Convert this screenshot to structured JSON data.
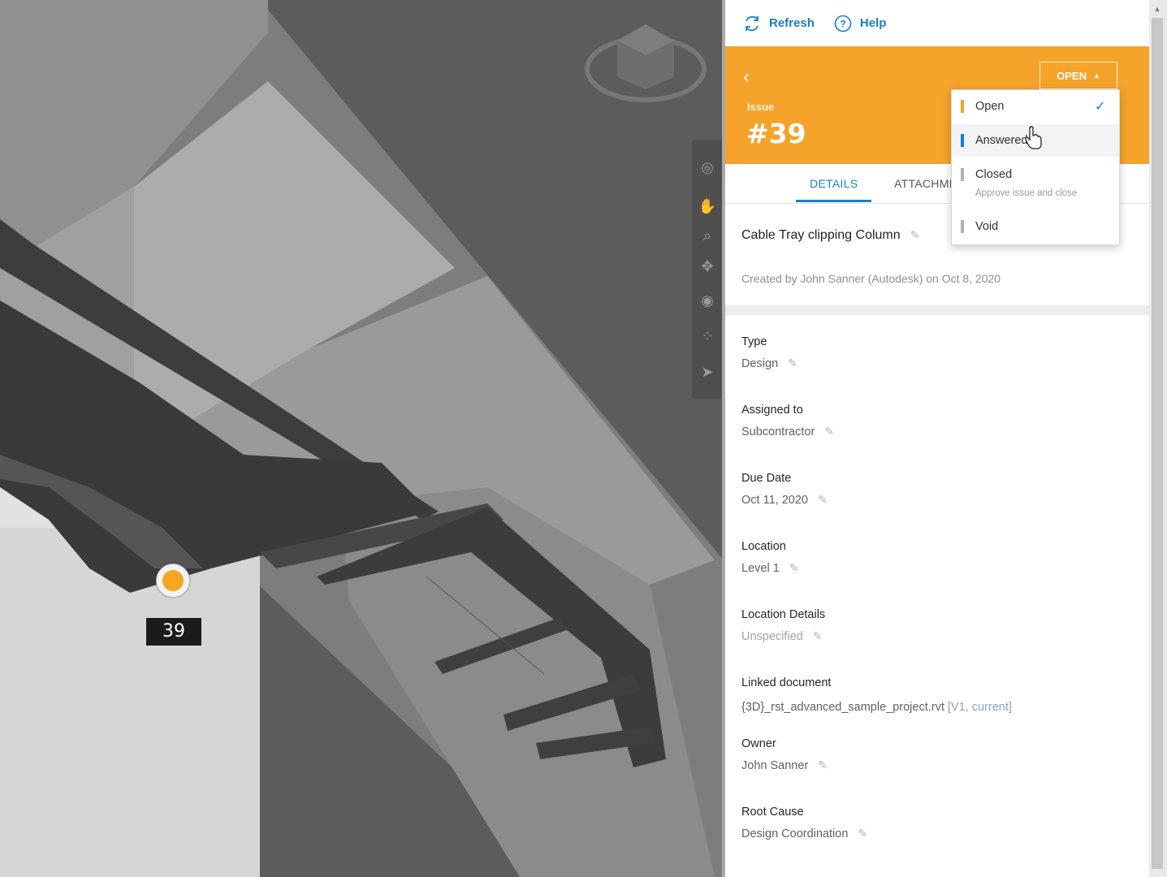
{
  "viewer": {
    "pin_number": "39",
    "toolbar_icons": [
      "orbit-icon",
      "pan-icon",
      "zoom-icon",
      "fit-view-icon",
      "look-icon",
      "walk-icon",
      "select-icon"
    ]
  },
  "panel": {
    "toolbar": {
      "refresh_label": "Refresh",
      "help_label": "Help"
    },
    "header": {
      "issue_label": "Issue",
      "issue_number": "#39",
      "status_button_label": "OPEN",
      "accent_color": "#f5a32a"
    },
    "tabs": [
      {
        "label": "DETAILS",
        "active": true
      },
      {
        "label": "ATTACHMI",
        "active": false
      }
    ],
    "title": "Cable Tray clipping Column",
    "created_by": "Created by John Sanner (Autodesk) on Oct 8, 2020",
    "fields": [
      {
        "label": "Type",
        "value": "Design"
      },
      {
        "label": "Assigned to",
        "value": "Subcontractor"
      },
      {
        "label": "Due Date",
        "value": "Oct 11, 2020"
      },
      {
        "label": "Location",
        "value": "Level 1"
      },
      {
        "label": "Location Details",
        "value": "Unspecified"
      },
      {
        "label": "Linked document",
        "value": "{3D}_rst_advanced_sample_project.rvt",
        "version": "[V1, current]"
      },
      {
        "label": "Owner",
        "value": "John Sanner"
      },
      {
        "label": "Root Cause",
        "value": "Design Coordination"
      }
    ]
  },
  "status_dropdown": {
    "options": [
      {
        "label": "Open",
        "color": "#f5a32a",
        "selected": true
      },
      {
        "label": "Answered",
        "color": "#1b7fc4",
        "hovered": true
      },
      {
        "label": "Closed",
        "color": "#b0b0b0",
        "sublabel": "Approve issue and close"
      },
      {
        "label": "Void",
        "color": "#b0b0b0"
      }
    ]
  }
}
